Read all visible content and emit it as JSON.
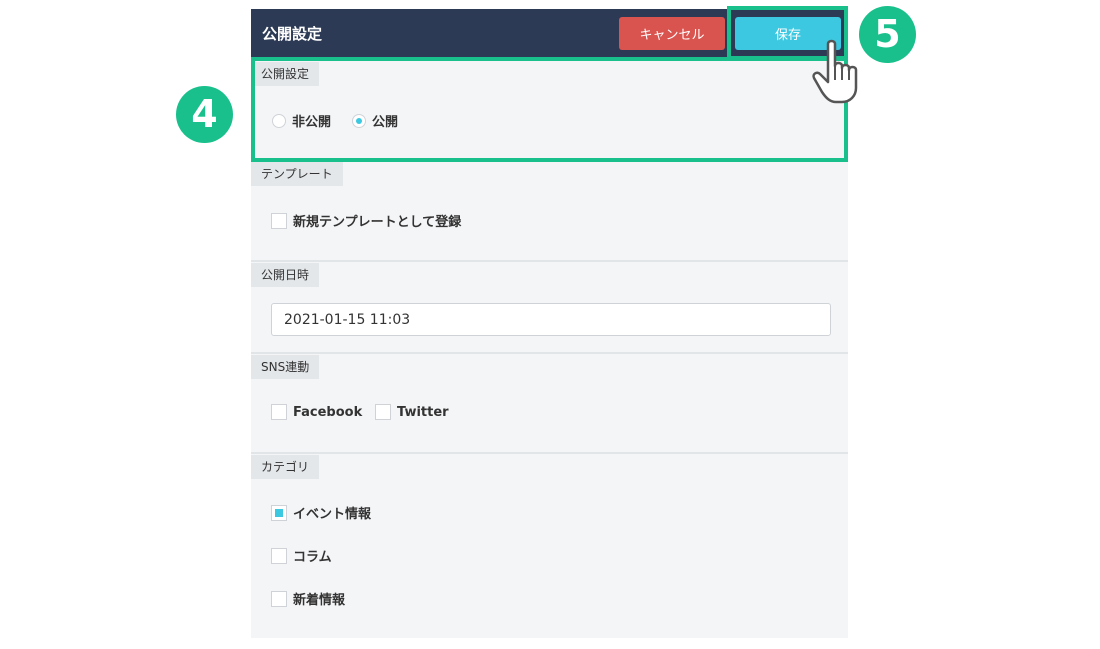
{
  "header": {
    "title": "公開設定",
    "cancel_label": "キャンセル",
    "save_label": "保存"
  },
  "sections": {
    "visibility": {
      "label": "公開設定",
      "options": [
        "非公開",
        "公開"
      ],
      "selected": "公開"
    },
    "template": {
      "label": "テンプレート",
      "checkbox_label": "新規テンプレートとして登録",
      "checked": false
    },
    "publish_date": {
      "label": "公開日時",
      "value": "2021-01-15 11:03"
    },
    "sns": {
      "label": "SNS連動",
      "options": [
        {
          "label": "Facebook",
          "checked": false
        },
        {
          "label": "Twitter",
          "checked": false
        }
      ]
    },
    "category": {
      "label": "カテゴリ",
      "options": [
        {
          "label": "イベント情報",
          "checked": true
        },
        {
          "label": "コラム",
          "checked": false
        },
        {
          "label": "新着情報",
          "checked": false
        }
      ]
    }
  },
  "annotations": {
    "step4": "4",
    "step5": "5"
  },
  "colors": {
    "header_bg": "#2c3a55",
    "cancel": "#d9534f",
    "save": "#3cc8e0",
    "highlight": "#19c08c"
  },
  "icons": {
    "pointer": "hand-pointer-icon"
  }
}
